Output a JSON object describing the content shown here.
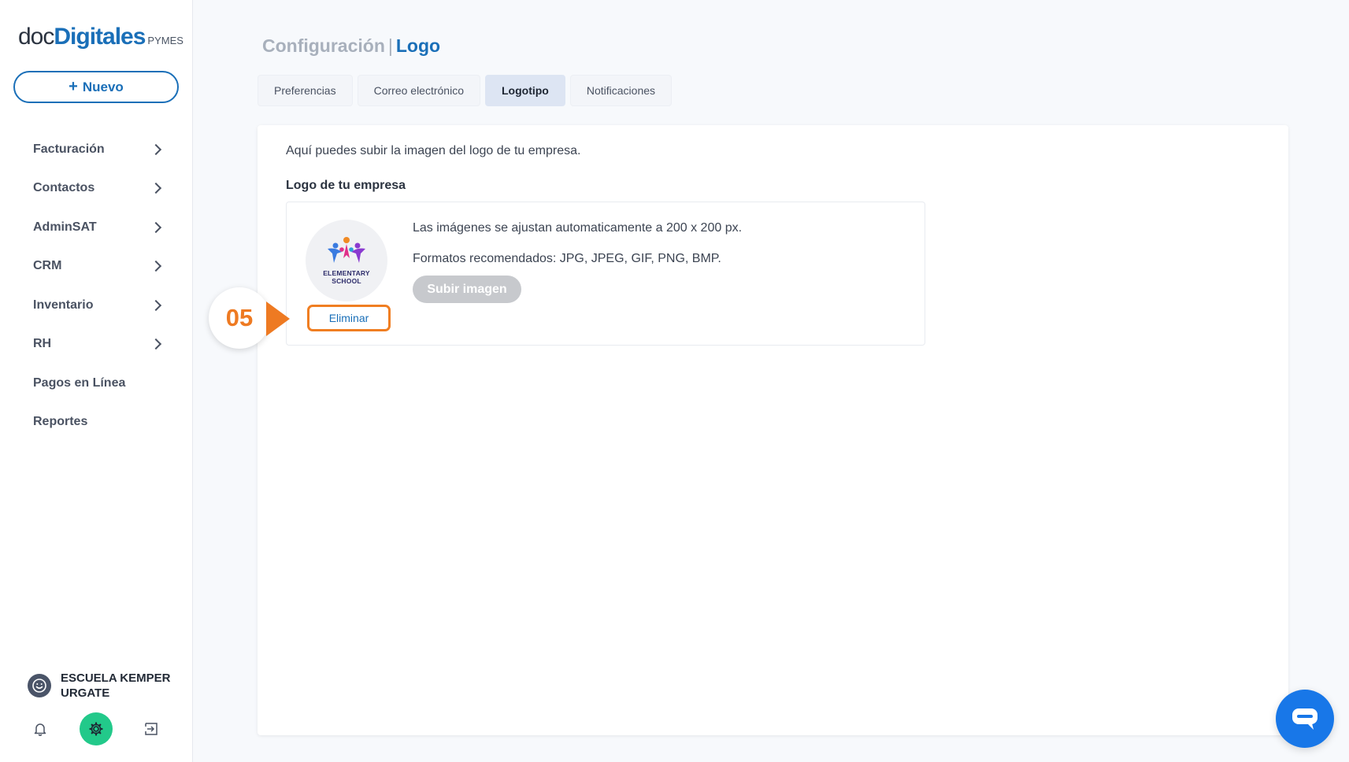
{
  "brand": {
    "part1": "doc",
    "part2": "Digitales",
    "suffix": "PYMES"
  },
  "new_button": {
    "plus": "+",
    "label": "Nuevo"
  },
  "menu": [
    {
      "label": "Facturación",
      "has_children": true
    },
    {
      "label": "Contactos",
      "has_children": true
    },
    {
      "label": "AdminSAT",
      "has_children": true
    },
    {
      "label": "CRM",
      "has_children": true
    },
    {
      "label": "Inventario",
      "has_children": true
    },
    {
      "label": "RH",
      "has_children": true
    },
    {
      "label": "Pagos en Línea",
      "has_children": false
    },
    {
      "label": "Reportes",
      "has_children": false
    }
  ],
  "user": {
    "name": "ESCUELA KEMPER URGATE"
  },
  "page": {
    "title_section": "Configuración",
    "title_separator": "|",
    "title_page": "Logo"
  },
  "tabs": [
    {
      "label": "Preferencias",
      "active": false
    },
    {
      "label": "Correo electrónico",
      "active": false
    },
    {
      "label": "Logotipo",
      "active": true
    },
    {
      "label": "Notificaciones",
      "active": false
    }
  ],
  "content": {
    "intro": "Aquí puedes subir la imagen del logo de tu empresa.",
    "section_title": "Logo de tu empresa",
    "info_size": "Las imágenes se ajustan automaticamente a 200 x 200 px.",
    "info_formats": "Formatos recomendados: JPG, JPEG, GIF, PNG, BMP.",
    "upload_label": "Subir imagen",
    "delete_label": "Eliminar",
    "logo_text_line1": "ELEMENTARY",
    "logo_text_line2": "SCHOOL"
  },
  "annotation": {
    "step": "05"
  },
  "colors": {
    "brand": "#1a6fb8",
    "accent": "#ee7a22",
    "gear_active": "#22c98a",
    "chat": "#1877e8"
  },
  "icons": {
    "bell": "bell-icon",
    "settings": "gear-icon",
    "logout": "logout-icon",
    "chat": "chat-icon",
    "avatar": "smiley-icon"
  }
}
